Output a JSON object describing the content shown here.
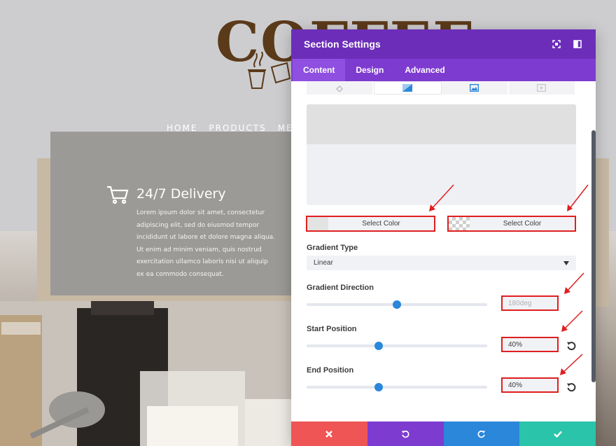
{
  "website": {
    "logo_text": "COFFEE",
    "nav": [
      "HOME",
      "PRODUCTS",
      "ME"
    ],
    "delivery_title": "24/7 Delivery",
    "delivery_body": "Lorem ipsum dolor sit amet, consectetur adipiscing elit, sed do eiusmod tempor incididunt ut labore et dolore magna aliqua. Ut enim ad minim veniam, quis nostrud exercitation ullamco laboris nisi ut aliquip ex ea commodo consequat."
  },
  "modal": {
    "title": "Section Settings",
    "tabs": [
      "Content",
      "Design",
      "Advanced"
    ],
    "active_tab": "Content",
    "background_type_icons": [
      "color-fill-icon",
      "gradient-icon",
      "image-icon",
      "video-icon"
    ],
    "color_pickers": [
      {
        "label": "Select Color",
        "swatch": "#e3e3e3"
      },
      {
        "label": "Select Color",
        "swatch": "transparent"
      }
    ],
    "gradient_type": {
      "label": "Gradient Type",
      "value": "Linear"
    },
    "gradient_direction": {
      "label": "Gradient Direction",
      "value": "180deg",
      "slider_fraction": 0.5
    },
    "start_position": {
      "label": "Start Position",
      "value": "40%",
      "slider_fraction": 0.4
    },
    "end_position": {
      "label": "End Position",
      "value": "40%",
      "slider_fraction": 0.4
    },
    "footer_buttons": [
      "discard-icon",
      "undo-icon",
      "redo-icon",
      "save-icon"
    ]
  },
  "colors": {
    "header_purple": "#6c2eb9",
    "tabs_purple": "#7e3bd0",
    "accent_blue": "#2b87da",
    "highlight_red": "#e01f1f",
    "discard_red": "#ef5555",
    "undo_purple": "#7e3bd0",
    "redo_blue": "#2b87da",
    "save_green": "#29c4a9"
  }
}
